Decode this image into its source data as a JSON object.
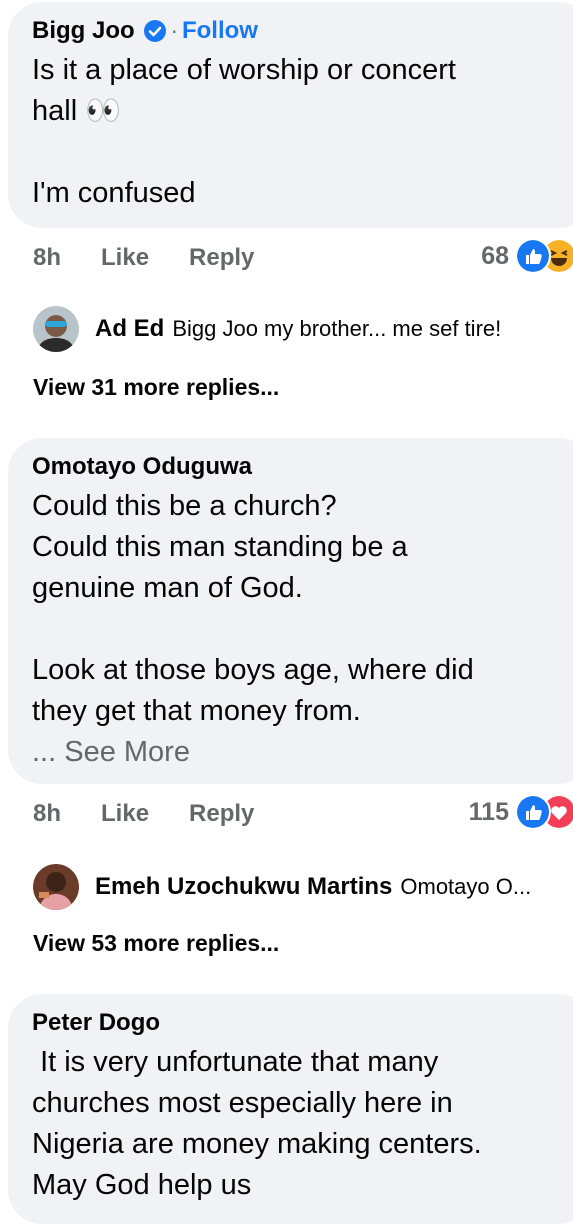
{
  "comments": [
    {
      "author": "Bigg Joo",
      "follow": "Follow",
      "dot": "·",
      "text": "Is it a place of worship or concert\nhall 👀\n\nI'm confused",
      "time": "8h",
      "like": "Like",
      "reply": "Reply",
      "reaction_count": "68",
      "reply_preview": {
        "name": "Ad Ed",
        "text": "Bigg Joo my brother... me sef tire!"
      },
      "view_more": "View 31 more replies..."
    },
    {
      "author": "Omotayo Oduguwa",
      "text": "Could this be a church?\nCould this man standing be a\ngenuine man of God.\n\nLook at those boys age, where did\nthey get that money from.",
      "see_more": "... See More",
      "time": "8h",
      "like": "Like",
      "reply": "Reply",
      "reaction_count": "115",
      "reply_preview": {
        "name": "Emeh Uzochukwu Martins",
        "text": "Omotayo O..."
      },
      "view_more": "View 53 more replies..."
    },
    {
      "author": "Peter Dogo",
      "text": " It is very unfortunate that many\nchurches most especially here in\nNigeria are money making centers.\nMay God help us"
    }
  ],
  "colors": {
    "link": "#1877f2",
    "bubble": "#f0f2f5",
    "muted": "#65676b",
    "like_blue": "#1877f2",
    "love_red": "#f33e58"
  },
  "icons": [
    "verified-badge-icon",
    "like-reaction-icon",
    "haha-reaction-icon",
    "love-reaction-icon"
  ]
}
